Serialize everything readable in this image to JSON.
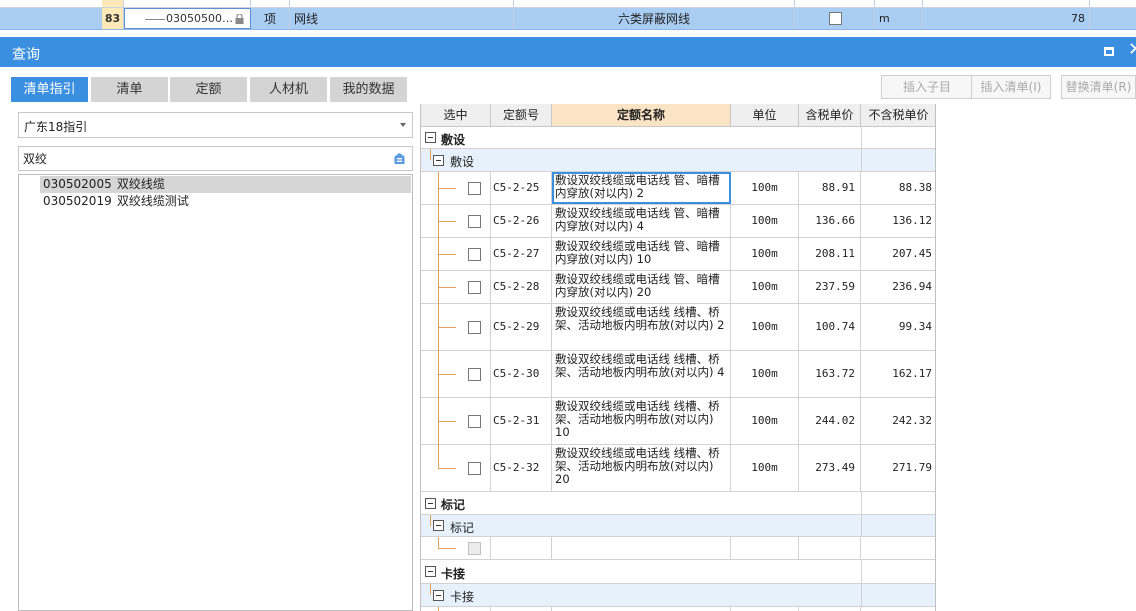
{
  "background_sheet": {
    "row_number": "83",
    "code": "03050500…",
    "type": "项",
    "name": "网线",
    "description": "六类屏蔽网线",
    "unit": "m",
    "quantity": "78"
  },
  "dialog": {
    "title": "查询"
  },
  "tabs": [
    {
      "label": "清单指引"
    },
    {
      "label": "清单"
    },
    {
      "label": "定额"
    },
    {
      "label": "人材机"
    },
    {
      "label": "我的数据"
    }
  ],
  "toolbar": {
    "insert_child": "插入子目",
    "insert_list": "插入清单(I)",
    "replace_list": "替换清单(R)"
  },
  "left_panel": {
    "guide_select_value": "广东18指引",
    "search_value": "双绞",
    "results": [
      {
        "code": "030502005",
        "name": "双绞线缆"
      },
      {
        "code": "030502019",
        "name": "双绞线缆测试"
      }
    ]
  },
  "grid": {
    "headers": {
      "select": "选中",
      "quota_no": "定额号",
      "quota_name": "定额名称",
      "unit": "单位",
      "tax_price": "含税单价",
      "notax_price": "不含税单价"
    },
    "groups": [
      {
        "label": "敷设",
        "sub": "敷设"
      },
      {
        "label": "标记",
        "sub": "标记"
      },
      {
        "label": "卡接",
        "sub": "卡接"
      }
    ],
    "rows": [
      {
        "code": "C5-2-25",
        "name": "敷设双绞线缆或电话线 管、暗槽内穿放(对以内) 2",
        "unit": "100m",
        "tax": "88.91",
        "notax": "88.38"
      },
      {
        "code": "C5-2-26",
        "name": "敷设双绞线缆或电话线 管、暗槽内穿放(对以内) 4",
        "unit": "100m",
        "tax": "136.66",
        "notax": "136.12"
      },
      {
        "code": "C5-2-27",
        "name": "敷设双绞线缆或电话线 管、暗槽内穿放(对以内) 10",
        "unit": "100m",
        "tax": "208.11",
        "notax": "207.45"
      },
      {
        "code": "C5-2-28",
        "name": "敷设双绞线缆或电话线 管、暗槽内穿放(对以内) 20",
        "unit": "100m",
        "tax": "237.59",
        "notax": "236.94"
      },
      {
        "code": "C5-2-29",
        "name": "敷设双绞线缆或电话线 线槽、桥架、活动地板内明布放(对以内) 2",
        "unit": "100m",
        "tax": "100.74",
        "notax": "99.34"
      },
      {
        "code": "C5-2-30",
        "name": "敷设双绞线缆或电话线 线槽、桥架、活动地板内明布放(对以内) 4",
        "unit": "100m",
        "tax": "163.72",
        "notax": "162.17"
      },
      {
        "code": "C5-2-31",
        "name": "敷设双绞线缆或电话线 线槽、桥架、活动地板内明布放(对以内) 10",
        "unit": "100m",
        "tax": "244.02",
        "notax": "242.32"
      },
      {
        "code": "C5-2-32",
        "name": "敷设双绞线缆或电话线 线槽、桥架、活动地板内明布放(对以内) 20",
        "unit": "100m",
        "tax": "273.49",
        "notax": "271.79"
      }
    ]
  }
}
